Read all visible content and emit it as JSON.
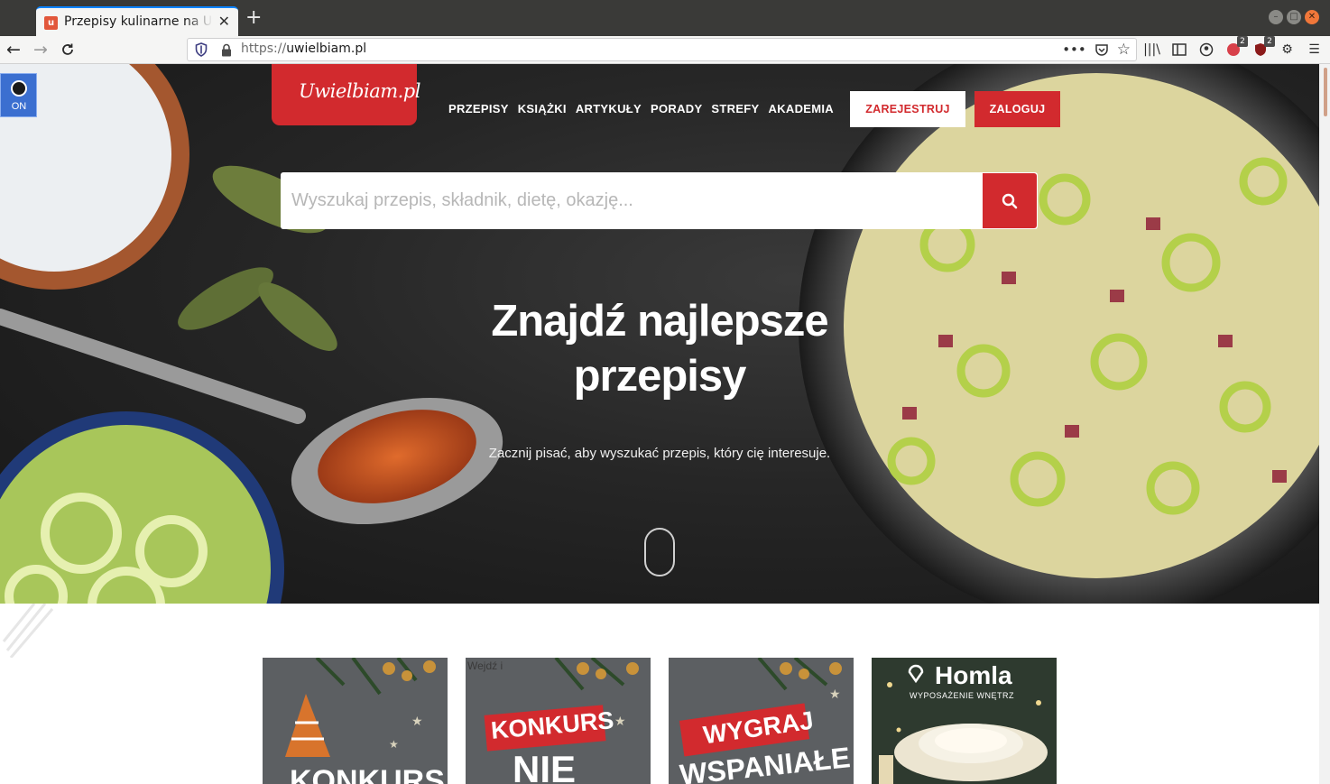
{
  "browser": {
    "tab_title": "Przepisy kulinarne na Uwielbiam.pl",
    "tab_favicon": "u",
    "url_scheme": "https://",
    "url_host": "uwielbiam.pl",
    "badge_count_1": "2",
    "badge_count_2": "2"
  },
  "site": {
    "logo": "Uwielbiam.pl",
    "nav": [
      "PRZEPISY",
      "KSIĄŻKI",
      "ARTYKUŁY",
      "PORADY",
      "STREFY",
      "AKADEMIA"
    ],
    "register_label": "ZAREJESTRUJ",
    "login_label": "ZALOGUJ",
    "search_placeholder": "Wyszukaj przepis, składnik, dietę, okazję...",
    "headline": "Znajdź najlepsze przepisy",
    "subline": "Zacznij pisać, aby wyszukać przepis, który cię interesuje.",
    "toggle_label": "ON"
  },
  "cards": [
    {
      "text": "KONKURS"
    },
    {
      "tag": "Wejdź i",
      "line1": "KONKURS",
      "line2": "NIE"
    },
    {
      "line1": "WYGRAJ",
      "line2": "WSPANIAŁE"
    },
    {
      "brand": "Homla",
      "sub": "WYPOSAŻENIE WNĘTRZ"
    }
  ],
  "colors": {
    "brand_red": "#d22a2e",
    "chrome_dark": "#3a3a38",
    "toggle_blue": "#3b6fd0"
  }
}
